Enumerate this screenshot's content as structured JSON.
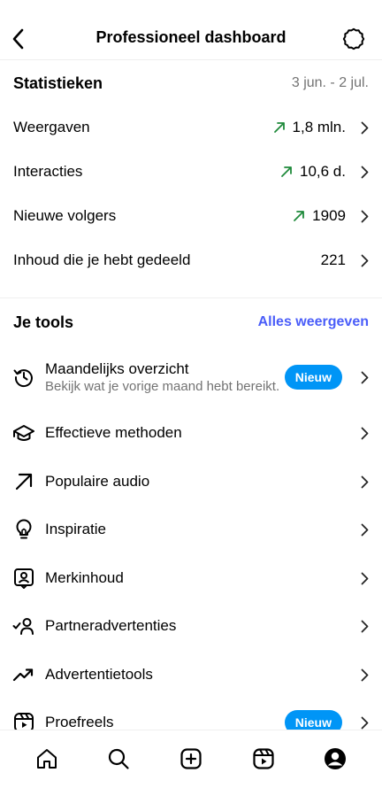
{
  "header": {
    "title": "Professioneel dashboard",
    "back_icon": "chevron-left-icon",
    "settings_icon": "gear-icon"
  },
  "stats": {
    "title": "Statistieken",
    "date_range": "3 jun. - 2 jul.",
    "trend_color": "#1f8a3b",
    "rows": [
      {
        "label": "Weergaven",
        "value": "1,8 mln.",
        "trend": "up"
      },
      {
        "label": "Interacties",
        "value": "10,6 d.",
        "trend": "up"
      },
      {
        "label": "Nieuwe volgers",
        "value": "1909",
        "trend": "up"
      },
      {
        "label": "Inhoud die je hebt gedeeld",
        "value": "221",
        "trend": "none"
      }
    ]
  },
  "tools": {
    "title": "Je tools",
    "see_all": "Alles weergeven",
    "items": [
      {
        "name": "Maandelijks overzicht",
        "subtitle": "Bekijk wat je vorige maand hebt bereikt.",
        "badge": "Nieuw",
        "icon": "history-icon"
      },
      {
        "name": "Effectieve methoden",
        "icon": "graduation-cap-icon"
      },
      {
        "name": "Populaire audio",
        "icon": "arrow-up-right-icon"
      },
      {
        "name": "Inspiratie",
        "icon": "lightbulb-icon"
      },
      {
        "name": "Merkinhoud",
        "icon": "branded-content-icon"
      },
      {
        "name": "Partneradvertenties",
        "icon": "partner-ads-icon"
      },
      {
        "name": "Advertentietools",
        "icon": "trending-icon"
      },
      {
        "name": "Proefreels",
        "badge": "Nieuw",
        "icon": "reels-icon"
      }
    ]
  },
  "bottom_nav": {
    "tabs": [
      "home-icon",
      "search-icon",
      "create-icon",
      "reels-icon",
      "profile-icon"
    ]
  },
  "colors": {
    "accent_link": "#4a5df9",
    "badge": "#0095f6",
    "secondary_text": "#737373"
  }
}
